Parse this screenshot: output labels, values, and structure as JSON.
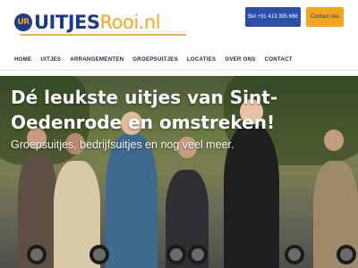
{
  "brand": {
    "logo_mark": "UR",
    "name_part1": "UITJES",
    "name_part2": "Rooi.nl"
  },
  "header": {
    "phone_button": "Bel +31 413 395 666",
    "contact_button": "Contact ons"
  },
  "nav": {
    "items": [
      "HOME",
      "UITJES",
      "ARRANGEMENTEN",
      "GROEPSUITJES",
      "LOCATIES",
      "OVER ONS",
      "CONTACT"
    ]
  },
  "hero": {
    "title": "Dé leukste uitjes van Sint-Oedenrode en omstreken!",
    "subtitle": "Groepsuitjes, bedrijfsuitjes en nog veel meer."
  },
  "colors": {
    "brand_blue": "#1d3a8a",
    "brand_orange": "#f2a51e",
    "button_blue": "#2b4ea8"
  }
}
